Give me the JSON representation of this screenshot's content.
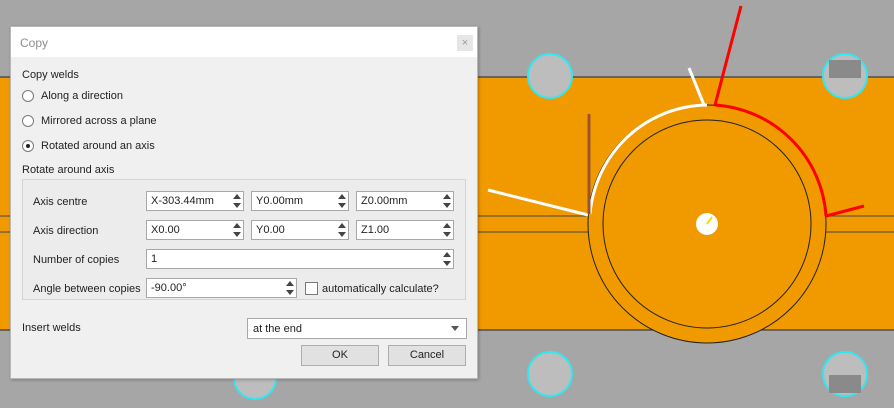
{
  "dialog": {
    "title": "Copy",
    "close_glyph": "×",
    "copy_welds_label": "Copy welds",
    "modes": [
      {
        "label": "Along a direction",
        "selected": false
      },
      {
        "label": "Mirrored across a plane",
        "selected": false
      },
      {
        "label": "Rotated around an axis",
        "selected": true
      }
    ],
    "rotate_section_label": "Rotate around axis",
    "axis_centre": {
      "label": "Axis centre",
      "x": "X-303.44mm",
      "y": "Y0.00mm",
      "z": "Z0.00mm"
    },
    "axis_direction": {
      "label": "Axis direction",
      "x": "X0.00",
      "y": "Y0.00",
      "z": "Z1.00"
    },
    "number_of_copies": {
      "label": "Number of copies",
      "value": "1"
    },
    "angle_between_copies": {
      "label": "Angle between copies",
      "value": "-90.00°",
      "auto_label": "automatically calculate?",
      "auto_checked": false
    },
    "insert_welds": {
      "label": "Insert welds",
      "value": "at the end"
    },
    "ok_label": "OK",
    "cancel_label": "Cancel"
  },
  "colors": {
    "part_fill": "#f09a00",
    "background": "#a6a6a6",
    "hole_outline": "#34e6f0",
    "weld_red": "#ff0000",
    "weld_white": "#ffffff",
    "weld_brown": "#a0522d"
  }
}
